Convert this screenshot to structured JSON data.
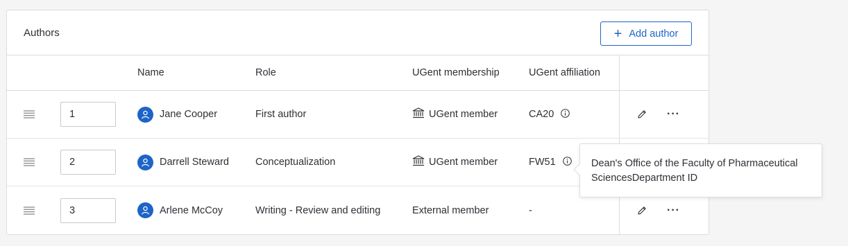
{
  "card": {
    "title": "Authors",
    "add_button_label": "Add author"
  },
  "table": {
    "headers": {
      "name": "Name",
      "role": "Role",
      "membership": "UGent membership",
      "affiliation": "UGent affiliation"
    },
    "rows": [
      {
        "position": "1",
        "name": "Jane Cooper",
        "role": "First author",
        "membership": "UGent member",
        "membership_icon": "institution-icon",
        "affiliation": "CA20",
        "has_info": true
      },
      {
        "position": "2",
        "name": "Darrell Steward",
        "role": "Conceptualization",
        "membership": "UGent member",
        "membership_icon": "institution-icon",
        "affiliation": "FW51",
        "has_info": true
      },
      {
        "position": "3",
        "name": "Arlene McCoy",
        "role": "Writing - Review and editing",
        "membership": "External member",
        "membership_icon": null,
        "affiliation": "-",
        "has_info": false
      }
    ]
  },
  "tooltip": {
    "text": "Dean's Office of the Faculty of Pharmaceutical SciencesDepartment ID"
  },
  "colors": {
    "accent": "#1e64c8",
    "border": "#dcdcdc",
    "text": "#2d3035"
  }
}
